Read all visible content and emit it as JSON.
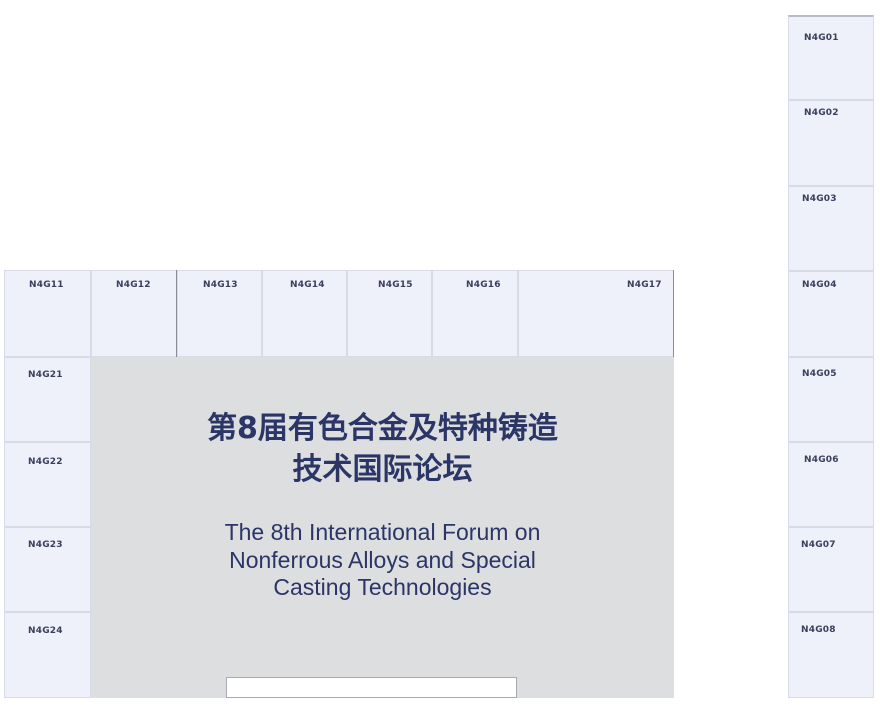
{
  "booths": {
    "N4G01": "N4G01",
    "N4G02": "N4G02",
    "N4G03": "N4G03",
    "N4G04": "N4G04",
    "N4G05": "N4G05",
    "N4G06": "N4G06",
    "N4G07": "N4G07",
    "N4G08": "N4G08",
    "N4G11": "N4G11",
    "N4G12": "N4G12",
    "N4G13": "N4G13",
    "N4G14": "N4G14",
    "N4G15": "N4G15",
    "N4G16": "N4G16",
    "N4G17": "N4G17",
    "N4G21": "N4G21",
    "N4G22": "N4G22",
    "N4G23": "N4G23",
    "N4G24": "N4G24"
  },
  "forum": {
    "cn_line1": "第8届有色合金及特种铸造",
    "cn_line2": "技术国际论坛",
    "en_line1": "The 8th International Forum on",
    "en_line2": "Nonferrous Alloys and Special",
    "en_line3": "Casting Technologies"
  },
  "colors": {
    "booth_fill": "#eef0fa",
    "forum_fill": "#dcdee0",
    "title_color": "#2b3566"
  }
}
